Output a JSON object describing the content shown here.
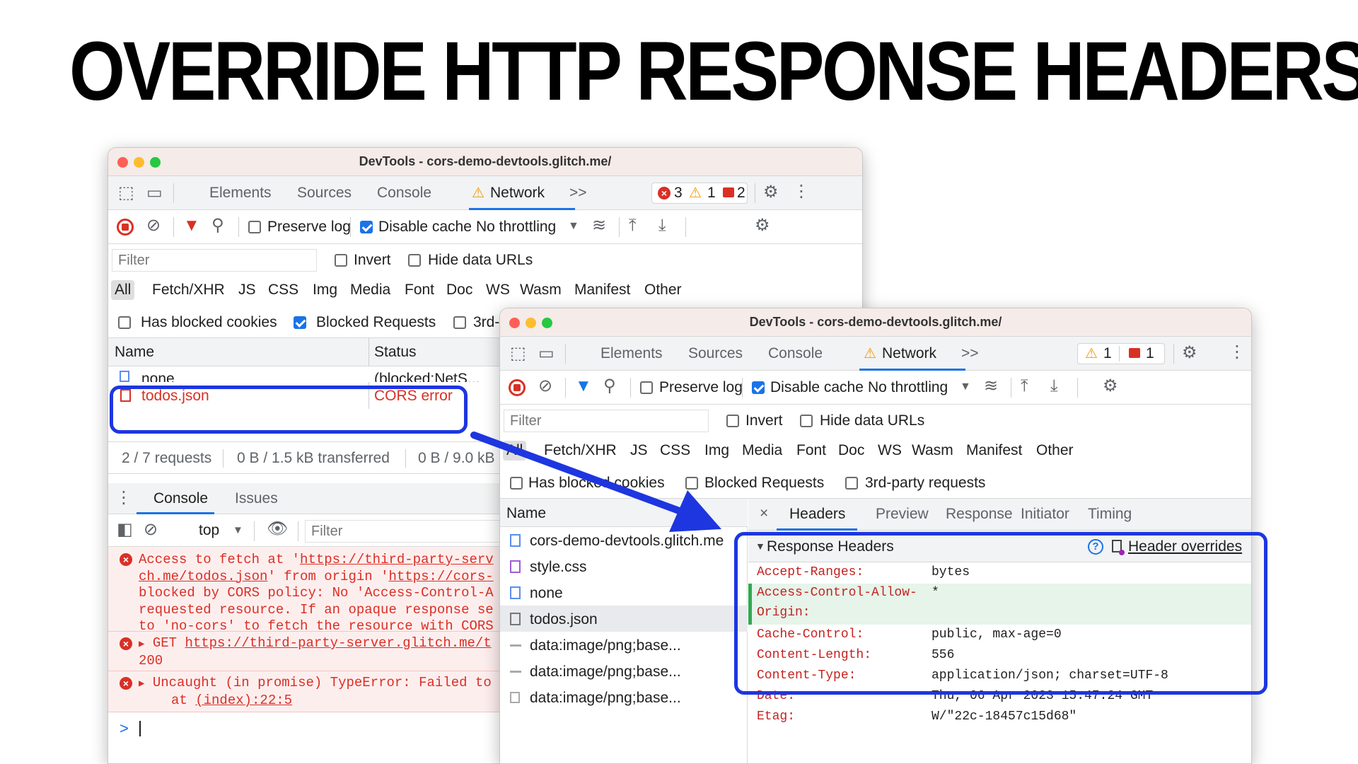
{
  "headline": "OVERRIDE HTTP RESPONSE HEADERS!",
  "window_title": "DevTools - cors-demo-devtools.glitch.me/",
  "main_tabs": {
    "elements": "Elements",
    "sources": "Sources",
    "console": "Console",
    "network": "Network",
    "more": ">>"
  },
  "win1_badges": {
    "errors": "3",
    "warnings": "1",
    "issues": "2"
  },
  "win2_badges": {
    "warnings": "1",
    "issues": "1"
  },
  "toolbar": {
    "preserve_log": "Preserve log",
    "disable_cache": "Disable cache",
    "throttling": "No throttling"
  },
  "filter_bar": {
    "placeholder": "Filter",
    "invert": "Invert",
    "hide_data_urls": "Hide data URLs"
  },
  "type_filters": [
    "All",
    "Fetch/XHR",
    "JS",
    "CSS",
    "Img",
    "Media",
    "Font",
    "Doc",
    "WS",
    "Wasm",
    "Manifest",
    "Other"
  ],
  "blocked_row": {
    "has_blocked_cookies": "Has blocked cookies",
    "blocked_requests": "Blocked Requests",
    "third_party_short": "3rd-",
    "third_party": "3rd-party requests"
  },
  "columns": {
    "name": "Name",
    "status": "Status"
  },
  "win1_requests": [
    {
      "name": "none",
      "status": "(blocked:NetS..."
    },
    {
      "name": "todos.json",
      "status": "CORS error"
    }
  ],
  "status_bar": {
    "requests": "2 / 7 requests",
    "transferred": "0 B / 1.5 kB transferred",
    "resources": "0 B / 9.0 kB"
  },
  "drawer_tabs": {
    "console": "Console",
    "issues": "Issues"
  },
  "console_toolbar": {
    "context": "top",
    "filter": "Filter"
  },
  "console_messages": {
    "m1_l1": "Access to fetch at '",
    "m1_l1_link": "https://third-party-serv",
    "m1_l2_link": "ch.me/todos.json",
    "m1_l2_mid": "' from origin '",
    "m1_l2_link2": "https://cors-",
    "m1_l3": "blocked by CORS policy: No 'Access-Control-A",
    "m1_l4": "requested resource. If an opaque response se",
    "m1_l5": "to 'no-cors' to fetch the resource with CORS",
    "m2_l1": "GET ",
    "m2_l1_link": "https://third-party-server.glitch.me/t",
    "m2_l2": "200",
    "m3_l1": "Uncaught (in promise) TypeError: Failed to",
    "m3_l2": "at ",
    "m3_l2_link": "(index):22:5",
    "prompt": ">"
  },
  "win2_requests": [
    {
      "name": "cors-demo-devtools.glitch.me",
      "icon": "document-icon"
    },
    {
      "name": "style.css",
      "icon": "stylesheet-icon"
    },
    {
      "name": "none",
      "icon": "document-icon"
    },
    {
      "name": "todos.json",
      "icon": "file-icon"
    },
    {
      "name": "data:image/png;base...",
      "icon": "image-icon"
    },
    {
      "name": "data:image/png;base...",
      "icon": "image-icon"
    },
    {
      "name": "data:image/png;base...",
      "icon": "image-icon"
    }
  ],
  "detail_tabs": {
    "close": "×",
    "headers": "Headers",
    "preview": "Preview",
    "response": "Response",
    "initiator": "Initiator",
    "timing": "Timing"
  },
  "response_headers": {
    "section_title": "Response Headers",
    "override_link": "Header overrides",
    "items": [
      {
        "name": "Accept-Ranges:",
        "value": "bytes"
      },
      {
        "name": "Access-Control-Allow-",
        "value": "*"
      },
      {
        "name": "Origin:",
        "value": ""
      },
      {
        "name": "Cache-Control:",
        "value": "public, max-age=0"
      },
      {
        "name": "Content-Length:",
        "value": "556"
      },
      {
        "name": "Content-Type:",
        "value": "application/json; charset=UTF-8"
      },
      {
        "name": "Date:",
        "value": "Thu, 06 Apr 2023 15:47:24 GMT"
      },
      {
        "name": "Etag:",
        "value": "W/\"22c-18457c15d68\""
      }
    ]
  },
  "colors": {
    "accent_blue": "#1a73e8",
    "error_red": "#d93025",
    "warning_orange": "#f29900",
    "callout_blue": "#1d36e0",
    "override_green": "#e6f4ea"
  }
}
